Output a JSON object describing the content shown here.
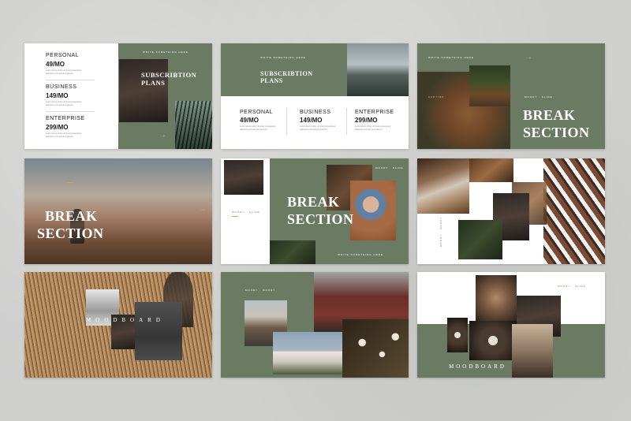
{
  "slide1": {
    "plans": [
      {
        "name": "PERSONAL",
        "price": "49/MO",
        "desc": "Lorem ipsum dolor sit amet consectetur adipiscing elit sed do eiusmod"
      },
      {
        "name": "BUSINESS",
        "price": "149/MO",
        "desc": "Lorem ipsum dolor sit amet consectetur adipiscing elit sed do eiusmod"
      },
      {
        "name": "ENTERPRISE",
        "price": "299/MO",
        "desc": "Lorem ipsum dolor sit amet consectetur adipiscing elit sed do eiusmod"
      }
    ],
    "tagline": "WRITE SOMETHING HERE",
    "title_line1": "SUBSCRIBTION",
    "title_line2": "PLANS",
    "arrow": "→"
  },
  "slide2": {
    "tagline": "WRITE SOMETHING HERE",
    "title_line1": "SUBSCRIBTION",
    "title_line2": "PLANS",
    "plans": [
      {
        "name": "PERSONAL",
        "price": "49/MO",
        "desc": "Lorem ipsum dolor sit amet consectetur adipiscing elit sed do eiusmod"
      },
      {
        "name": "BUSINESS",
        "price": "149/MO",
        "desc": "Lorem ipsum dolor sit amet consectetur adipiscing elit sed do eiusmod"
      },
      {
        "name": "ENTERPRISE",
        "price": "299/MO",
        "desc": "Lorem ipsum dolor sit amet consectetur adipiscing elit sed do eiusmod"
      }
    ]
  },
  "slide3": {
    "tagline": "WRITE SOMETHING HERE",
    "small_label": "MOODY · SLIDE",
    "title_line1": "BREAK",
    "title_line2": "SECTION",
    "arrow": "→",
    "caption": "CAPTION"
  },
  "slide4": {
    "title_line1": "BREAK",
    "title_line2": "SECTION",
    "arrow": "→"
  },
  "slide5": {
    "tagline_top": "MOODY · SLIDE",
    "small_label": "MOODY · SLIDE",
    "title_line1": "BREAK",
    "title_line2": "SECTION",
    "tagline_bottom": "WRITE SOMETHING HERE"
  },
  "slide6": {
    "vertical_label": "MOODY · MOODY"
  },
  "slide7": {
    "title": "MOODBOARD"
  },
  "slide8": {
    "tagline": "MOODY · MOODY"
  },
  "slide9": {
    "tagline": "MOODY · SLIDE",
    "title": "MOODBOARD"
  }
}
